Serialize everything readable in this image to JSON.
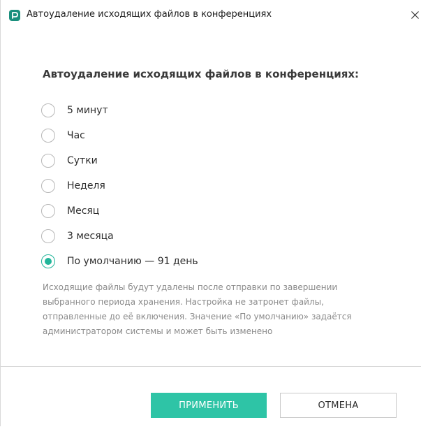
{
  "window": {
    "title": "Автоудаление исходящих файлов в конференциях",
    "app_icon": "app-logo-icon",
    "close_icon": "close-icon"
  },
  "dialog": {
    "heading": "Автоудаление исходящих файлов в конференциях:",
    "options": [
      {
        "label": "5 минут",
        "checked": false
      },
      {
        "label": "Час",
        "checked": false
      },
      {
        "label": "Сутки",
        "checked": false
      },
      {
        "label": "Неделя",
        "checked": false
      },
      {
        "label": "Месяц",
        "checked": false
      },
      {
        "label": "3 месяца",
        "checked": false
      },
      {
        "label": "По умолчанию — 91 день",
        "checked": true
      }
    ],
    "description_lines": [
      "Исходящие файлы будут удалены после отправки по завершении",
      "выбранного периода хранения. Настройка не затронет файлы,",
      "отправленные до её включения. Значение «По умолчанию» задаётся",
      "администратором системы и может быть изменено"
    ]
  },
  "buttons": {
    "apply_label": "ПРИМЕНИТЬ",
    "cancel_label": "ОТМЕНА"
  },
  "colors": {
    "accent": "#2ec4a6",
    "radio_checked": "#22b59a",
    "logo": "#1a8f7d"
  }
}
